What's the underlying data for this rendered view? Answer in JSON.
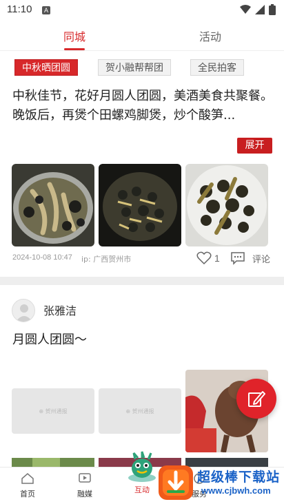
{
  "status_bar": {
    "time": "11:10",
    "a_badge": "A"
  },
  "tabs": [
    {
      "label": "同城",
      "active": true
    },
    {
      "label": "活动",
      "active": false
    }
  ],
  "chips": [
    {
      "label": "中秋晒团圆"
    },
    {
      "label": "贺小融帮帮团"
    },
    {
      "label": "全民拍客"
    }
  ],
  "post1": {
    "text": "中秋佳节，花好月圆人团圆，美酒美食共聚餐。晚饭后，再煲个田螺鸡脚煲，炒个酸笋...",
    "expand_label": "展开",
    "date": "2024-10-08 10:47",
    "location": "ip: 广西贺州市",
    "like_count": "1",
    "comment_label": "评论"
  },
  "post2": {
    "author": "张雅洁",
    "text": "月圆人团圆～",
    "placeholder_label": "⊕ 贺州通报"
  },
  "bottom_nav": [
    {
      "label": "首页",
      "icon": "home-icon"
    },
    {
      "label": "融媒",
      "icon": "media-icon"
    },
    {
      "label": "互动",
      "icon": "mascot-icon",
      "active": true
    },
    {
      "label": "服务",
      "icon": "service-icon"
    }
  ],
  "watermark": {
    "title": "超级棒下载站",
    "url": "www.cjbwh.com"
  },
  "colors": {
    "accent": "#d7282a",
    "fab": "#e0232a",
    "watermark": "#1a62c7"
  }
}
